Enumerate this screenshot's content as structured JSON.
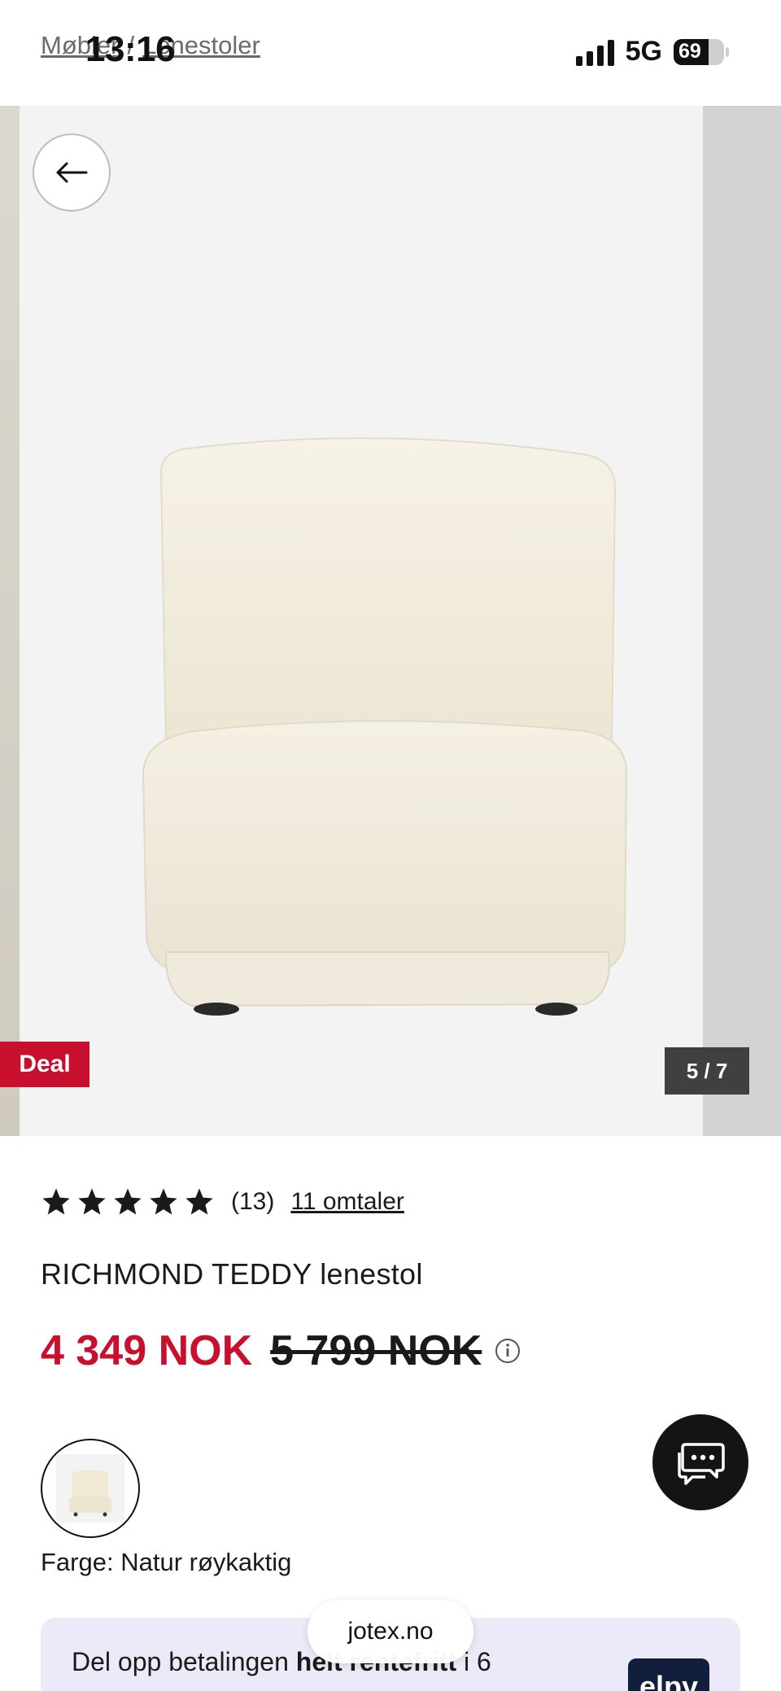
{
  "status_bar": {
    "time": "13:16",
    "network": "5G",
    "battery_percent": "69",
    "battery_level": 0.69
  },
  "breadcrumb": {
    "items": [
      "Møbler",
      "Lenestoler"
    ],
    "separator": "/"
  },
  "gallery": {
    "badge": "Deal",
    "counter": "5 / 7",
    "current_slide": 5,
    "total_slides": 7,
    "image": "cream teddy lounge chair"
  },
  "product": {
    "rating_stars": 5,
    "rating_count": "(13)",
    "reviews_link": "11 omtaler",
    "title": "RICHMOND TEDDY lenestol",
    "price_sale": "4 349 NOK",
    "price_original": "5 799 NOK",
    "color_label": "Farge: Natur røykaktig"
  },
  "payment_banner": {
    "text_before": "Del opp betalingen ",
    "text_bold": "helt rentefritt",
    "text_after": " i 6",
    "logo": "elpy"
  },
  "browser": {
    "url": "jotex.no"
  },
  "colors": {
    "sale_red": "#c8102e",
    "badge_red": "#c8102e",
    "chat_button": "#141414",
    "banner_bg": "#eceaf8"
  },
  "icons": [
    "back-arrow-icon",
    "star-icon",
    "info-icon",
    "chat-icon",
    "signal-icon",
    "battery-icon"
  ]
}
